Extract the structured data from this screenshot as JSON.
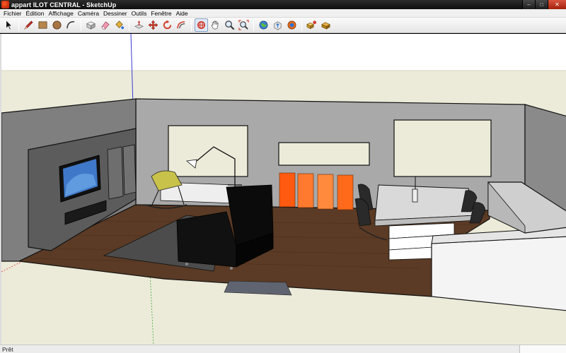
{
  "window": {
    "title": "appart ILOT CENTRAL - SketchUp",
    "minimize_glyph": "–",
    "maximize_glyph": "□",
    "close_glyph": "✕"
  },
  "menu": {
    "items": [
      "Fichier",
      "Édition",
      "Affichage",
      "Caméra",
      "Dessiner",
      "Outils",
      "Fenêtre",
      "Aide"
    ]
  },
  "toolbar": {
    "tools": [
      {
        "name": "select-tool",
        "icon": "arrow-icon"
      },
      {
        "name": "line-tool",
        "icon": "pencil-icon"
      },
      {
        "name": "rectangle-tool",
        "icon": "rectangle-icon"
      },
      {
        "name": "circle-tool",
        "icon": "circle-icon"
      },
      {
        "name": "arc-tool",
        "icon": "arc-icon"
      },
      {
        "name": "make-component-tool",
        "icon": "component-icon"
      },
      {
        "name": "eraser-tool",
        "icon": "eraser-icon"
      },
      {
        "name": "paint-bucket-tool",
        "icon": "paint-bucket-icon"
      },
      {
        "name": "push-pull-tool",
        "icon": "push-pull-icon"
      },
      {
        "name": "move-tool",
        "icon": "move-icon"
      },
      {
        "name": "rotate-tool",
        "icon": "rotate-icon"
      },
      {
        "name": "offset-tool",
        "icon": "offset-icon"
      },
      {
        "name": "orbit-tool",
        "icon": "orbit-icon"
      },
      {
        "name": "pan-tool",
        "icon": "hand-icon"
      },
      {
        "name": "zoom-tool",
        "icon": "magnifier-icon"
      },
      {
        "name": "zoom-extents-tool",
        "icon": "zoom-extents-icon"
      },
      {
        "name": "get-models-tool",
        "icon": "globe-icon"
      },
      {
        "name": "share-model-tool",
        "icon": "share-icon"
      },
      {
        "name": "google-earth-tool",
        "icon": "earth-icon"
      },
      {
        "name": "component-library-tool",
        "icon": "components-icon"
      },
      {
        "name": "extension-warehouse-tool",
        "icon": "warehouse-icon"
      }
    ]
  },
  "status": {
    "text": "Prêt"
  },
  "colors": {
    "sky": "#ffffff",
    "ground": "#ecebd9",
    "wall": "#9b9b9b",
    "floor": "#5a3a24",
    "sofa": "#0a0a0a",
    "orange_panel": "#ff6a1a",
    "rug": "#4e4e4e",
    "counter": "#d9d9d9"
  }
}
